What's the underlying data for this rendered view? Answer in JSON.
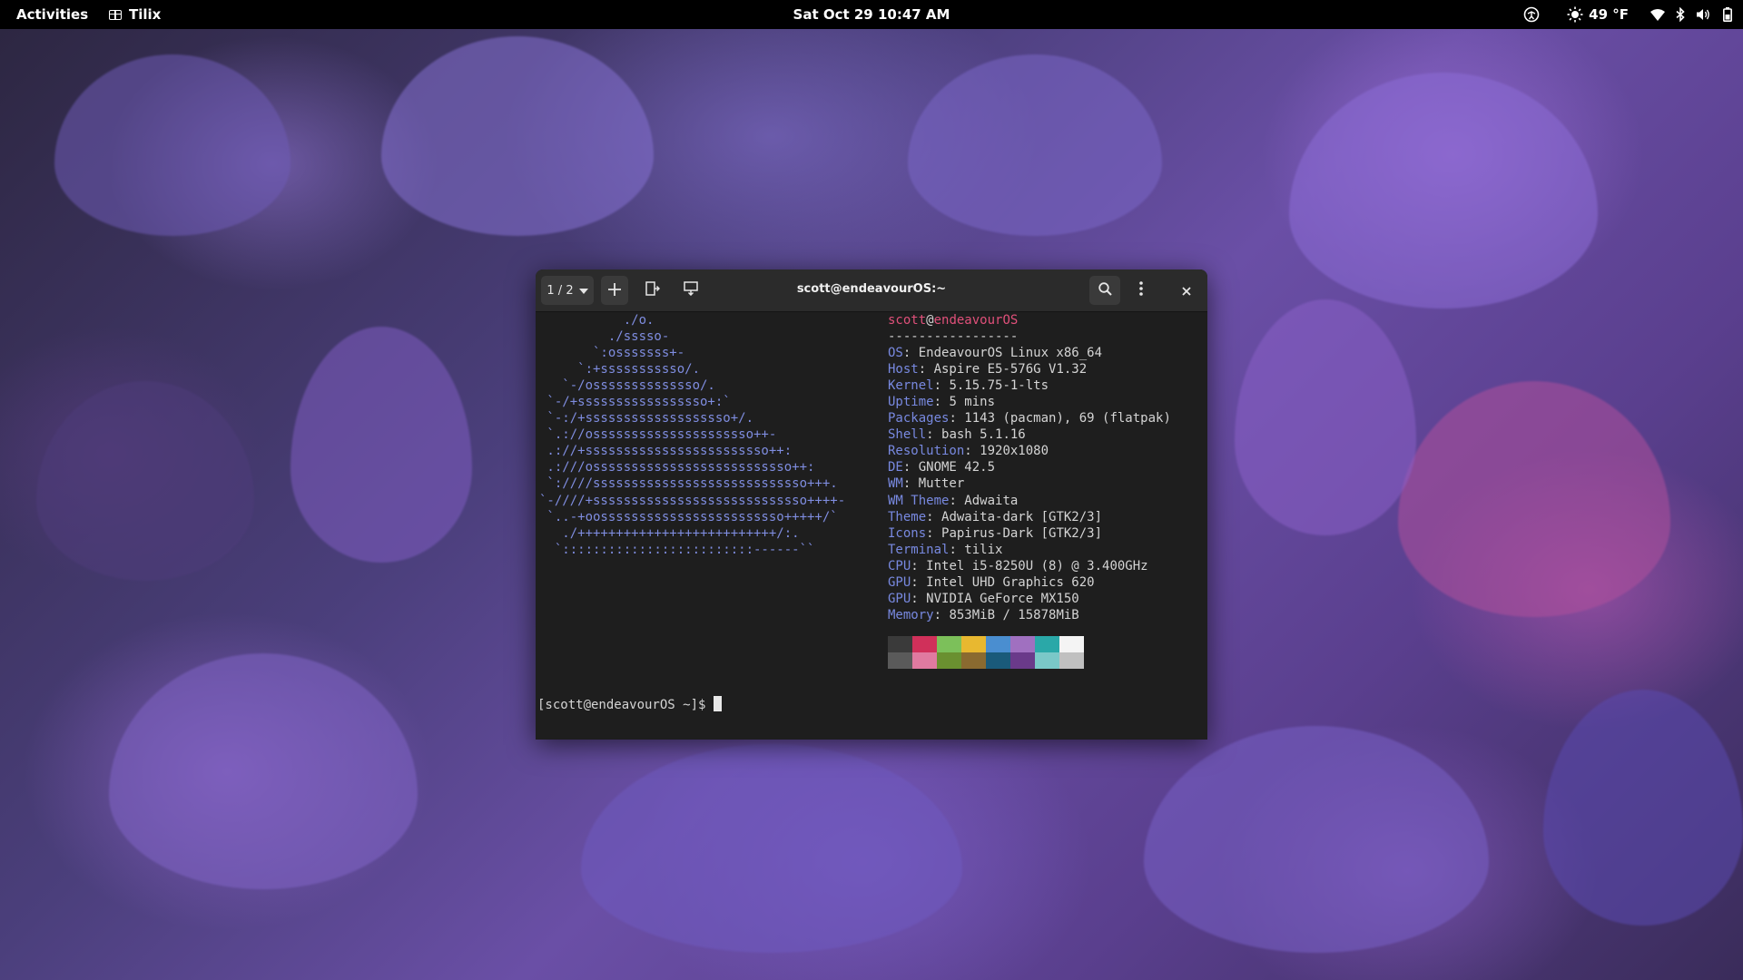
{
  "topbar": {
    "activities": "Activities",
    "app_name": "Tilix",
    "clock": "Sat Oct 29  10:47 AM",
    "weather_temp": "49 °F",
    "icons": [
      "accessibility-icon",
      "weather-sun-icon",
      "wifi-icon",
      "bluetooth-icon",
      "volume-icon",
      "battery-icon"
    ]
  },
  "window": {
    "title": "scott@endeavourOS:~",
    "session_switcher": "1 / 2",
    "buttons": [
      "add-session",
      "add-terminal-right",
      "add-terminal-down",
      "find",
      "menu",
      "close"
    ]
  },
  "neofetch": {
    "logo": [
      "           ./o.",
      "         ./sssso-",
      "       `:osssssss+-",
      "     `:+sssssssssso/.",
      "   `-/ossssssssssssso/.",
      " `-/+sssssssssssssssso+:`",
      " `-:/+sssssssssssssssssso+/.",
      " `.://osssssssssssssssssssso++-",
      " .://+ssssssssssssssssssssssso++:",
      " .:///ossssssssssssssssssssssssso++:",
      " `:////ssssssssssssssssssssssssssso+++.",
      "`-////+ssssssssssssssssssssssssssso++++-",
      " `..-+oossssssssssssssssssssssso+++++/`",
      "   ./++++++++++++++++++++++++++/:.",
      "  `:::::::::::::::::::::::::------``"
    ],
    "user": "scott",
    "at": "@",
    "host": "endeavourOS",
    "separator": "-----------------",
    "info": [
      {
        "key": "OS",
        "value": "EndeavourOS Linux x86_64"
      },
      {
        "key": "Host",
        "value": "Aspire E5-576G V1.32"
      },
      {
        "key": "Kernel",
        "value": "5.15.75-1-lts"
      },
      {
        "key": "Uptime",
        "value": "5 mins"
      },
      {
        "key": "Packages",
        "value": "1143 (pacman), 69 (flatpak)"
      },
      {
        "key": "Shell",
        "value": "bash 5.1.16"
      },
      {
        "key": "Resolution",
        "value": "1920x1080"
      },
      {
        "key": "DE",
        "value": "GNOME 42.5"
      },
      {
        "key": "WM",
        "value": "Mutter"
      },
      {
        "key": "WM Theme",
        "value": "Adwaita"
      },
      {
        "key": "Theme",
        "value": "Adwaita-dark [GTK2/3]"
      },
      {
        "key": "Icons",
        "value": "Papirus-Dark [GTK2/3]"
      },
      {
        "key": "Terminal",
        "value": "tilix"
      },
      {
        "key": "CPU",
        "value": "Intel i5-8250U (8) @ 3.400GHz"
      },
      {
        "key": "GPU",
        "value": "Intel UHD Graphics 620"
      },
      {
        "key": "GPU",
        "value": "NVIDIA GeForce MX150"
      },
      {
        "key": "Memory",
        "value": "853MiB / 15878MiB"
      }
    ],
    "palette_top": [
      "#3a3a3a",
      "#d0305a",
      "#7cc05a",
      "#e8b830",
      "#4a8ed0",
      "#a070c0",
      "#2aa8a8",
      "#f4f4f4"
    ],
    "palette_bottom": [
      "#5a5a5a",
      "#e07aa0",
      "#6a9030",
      "#8a6a30",
      "#1a5a7a",
      "#6a3a8a",
      "#7ac8c8",
      "#c0c0c0"
    ]
  },
  "prompt": "[scott@endeavourOS ~]$ "
}
